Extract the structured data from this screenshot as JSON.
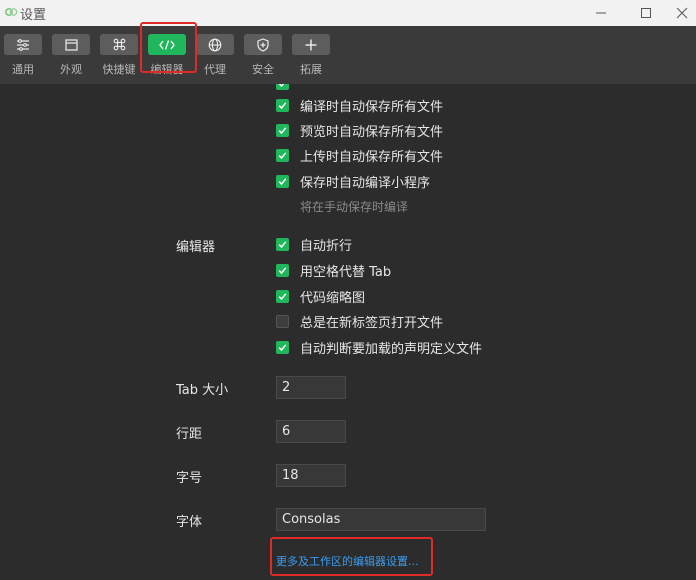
{
  "window": {
    "title": "设置"
  },
  "toolbar": {
    "items": [
      {
        "label": "通用",
        "icon": "sliders-icon"
      },
      {
        "label": "外观",
        "icon": "window-icon"
      },
      {
        "label": "快捷键",
        "icon": "command-key-icon"
      },
      {
        "label": "编辑器",
        "icon": "code-icon",
        "active": true
      },
      {
        "label": "代理",
        "icon": "globe-icon"
      },
      {
        "label": "安全",
        "icon": "shield-icon"
      },
      {
        "label": "拓展",
        "icon": "plus-icon"
      }
    ]
  },
  "save_options": [
    {
      "label": "编译时自动保存所有文件",
      "checked": true
    },
    {
      "label": "预览时自动保存所有文件",
      "checked": true
    },
    {
      "label": "上传时自动保存所有文件",
      "checked": true
    },
    {
      "label": "保存时自动编译小程序",
      "checked": true
    }
  ],
  "save_hint": "将在手动保存时编译",
  "editor": {
    "label": "编辑器",
    "options": [
      {
        "label": "自动折行",
        "checked": true
      },
      {
        "label": "用空格代替 Tab",
        "checked": true
      },
      {
        "label": "代码缩略图",
        "checked": true
      },
      {
        "label": "总是在新标签页打开文件",
        "checked": false
      },
      {
        "label": "自动判断要加载的声明定义文件",
        "checked": true
      }
    ]
  },
  "fields": {
    "tab_size": {
      "label": "Tab 大小",
      "value": "2"
    },
    "line_height": {
      "label": "行距",
      "value": "6"
    },
    "font_size": {
      "label": "字号",
      "value": "18"
    },
    "font_family": {
      "label": "字体",
      "value": "Consolas"
    }
  },
  "more_link": "更多及工作区的编辑器设置...",
  "colors": {
    "accent": "#1fb65c",
    "highlight": "#e02a2a",
    "link": "#3b9cf0"
  }
}
